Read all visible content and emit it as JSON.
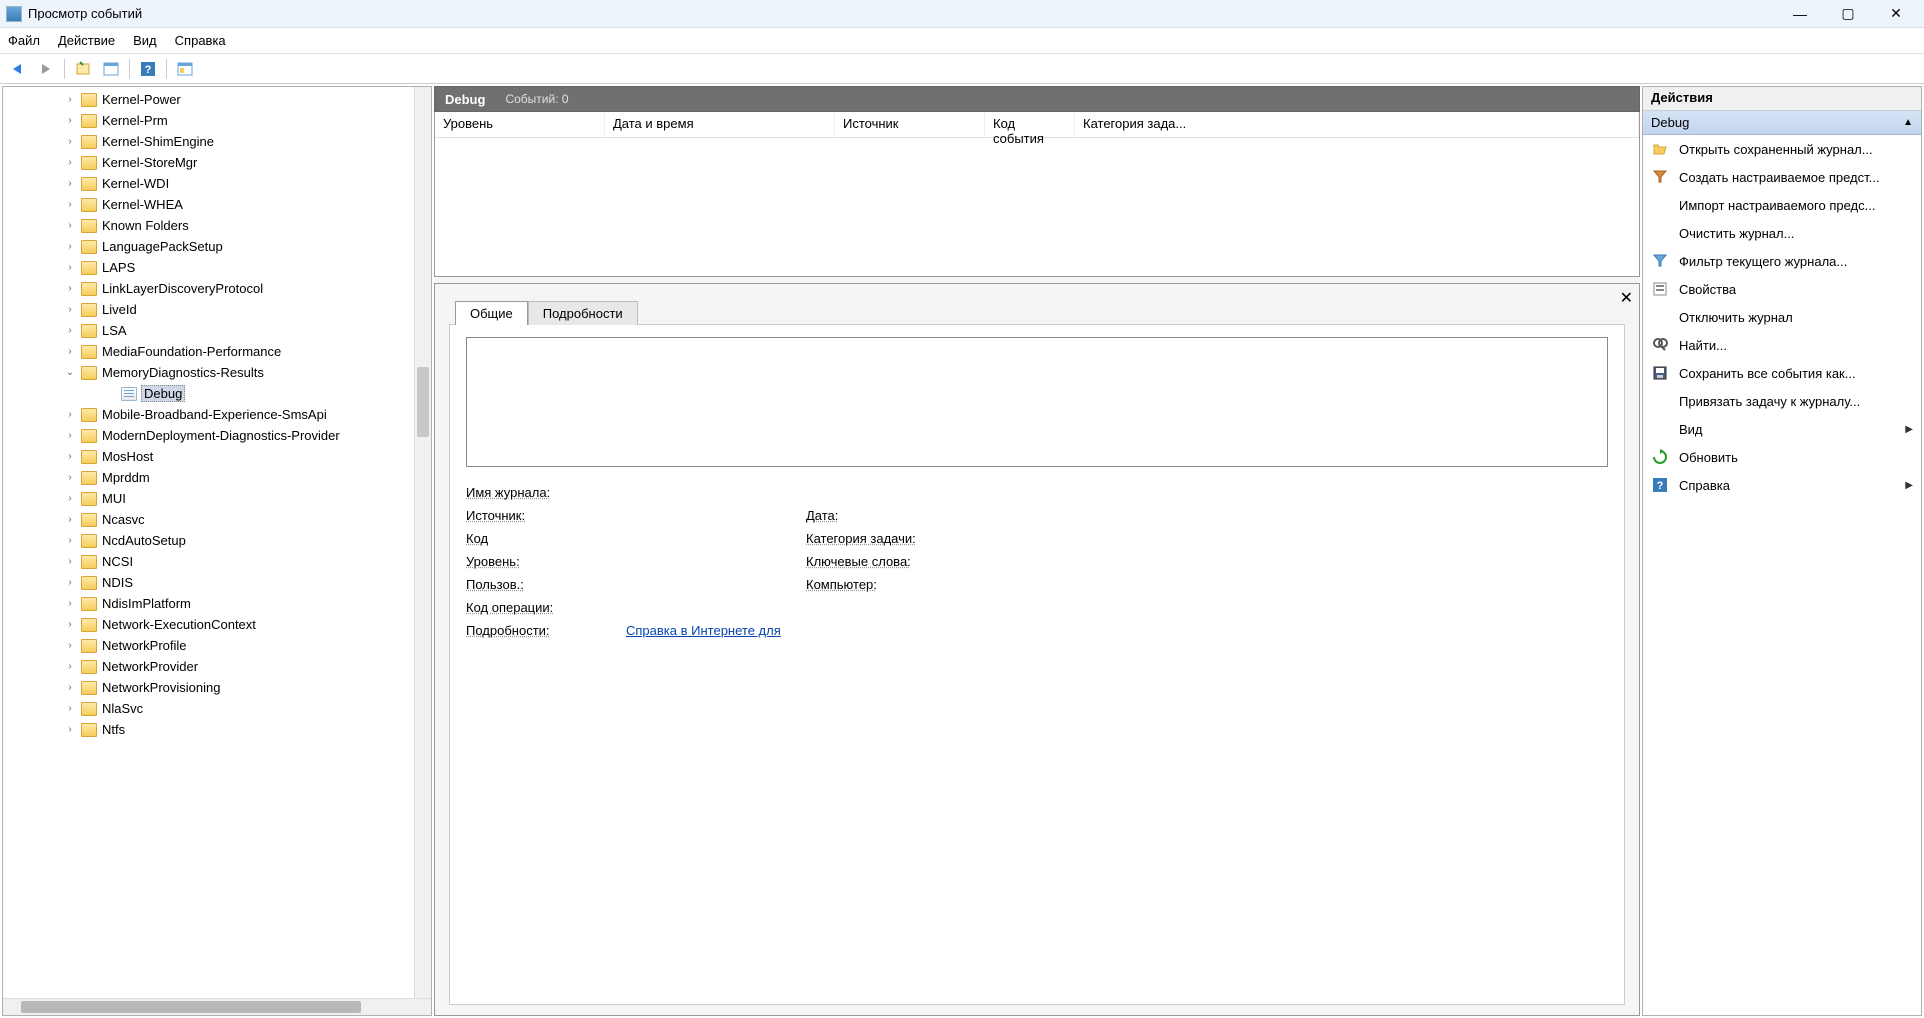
{
  "window": {
    "title": "Просмотр событий"
  },
  "menu": {
    "file": "Файл",
    "action": "Действие",
    "view": "Вид",
    "help": "Справка"
  },
  "tree": {
    "items": [
      {
        "label": "Kernel-Power",
        "exp": "›"
      },
      {
        "label": "Kernel-Prm",
        "exp": "›"
      },
      {
        "label": "Kernel-ShimEngine",
        "exp": "›"
      },
      {
        "label": "Kernel-StoreMgr",
        "exp": "›"
      },
      {
        "label": "Kernel-WDI",
        "exp": "›"
      },
      {
        "label": "Kernel-WHEA",
        "exp": "›"
      },
      {
        "label": "Known Folders",
        "exp": "›"
      },
      {
        "label": "LanguagePackSetup",
        "exp": "›"
      },
      {
        "label": "LAPS",
        "exp": "›"
      },
      {
        "label": "LinkLayerDiscoveryProtocol",
        "exp": "›"
      },
      {
        "label": "LiveId",
        "exp": "›"
      },
      {
        "label": "LSA",
        "exp": "›"
      },
      {
        "label": "MediaFoundation-Performance",
        "exp": "›"
      },
      {
        "label": "MemoryDiagnostics-Results",
        "exp": "⌄",
        "children": [
          {
            "label": "Debug",
            "selected": true
          }
        ]
      },
      {
        "label": "Mobile-Broadband-Experience-SmsApi",
        "exp": "›"
      },
      {
        "label": "ModernDeployment-Diagnostics-Provider",
        "exp": "›"
      },
      {
        "label": "MosHost",
        "exp": "›"
      },
      {
        "label": "Mprddm",
        "exp": "›"
      },
      {
        "label": "MUI",
        "exp": "›"
      },
      {
        "label": "Ncasvc",
        "exp": "›"
      },
      {
        "label": "NcdAutoSetup",
        "exp": "›"
      },
      {
        "label": "NCSI",
        "exp": "›"
      },
      {
        "label": "NDIS",
        "exp": "›"
      },
      {
        "label": "NdisImPlatform",
        "exp": "›"
      },
      {
        "label": "Network-ExecutionContext",
        "exp": "›"
      },
      {
        "label": "NetworkProfile",
        "exp": "›"
      },
      {
        "label": "NetworkProvider",
        "exp": "›"
      },
      {
        "label": "NetworkProvisioning",
        "exp": "›"
      },
      {
        "label": "NlaSvc",
        "exp": "›"
      },
      {
        "label": "Ntfs",
        "exp": "›"
      }
    ]
  },
  "center": {
    "title": "Debug",
    "sub": "Событий: 0",
    "columns": {
      "level": "Уровень",
      "date": "Дата и время",
      "source": "Источник",
      "code": "Код события",
      "task": "Категория зада..."
    }
  },
  "detail": {
    "tabGeneral": "Общие",
    "tabDetails": "Подробности",
    "fields": {
      "logname_l": "Имя журнала:",
      "source_l": "Источник:",
      "date_l": "Дата:",
      "eventid_l": "Код",
      "taskcat_l": "Категория задачи:",
      "level_l": "Уровень:",
      "keywords_l": "Ключевые слова:",
      "user_l": "Пользов.:",
      "computer_l": "Компьютер:",
      "opcode_l": "Код операции:",
      "moreinfo_l": "Подробности:",
      "moreinfo_link": "Справка в Интернете для "
    }
  },
  "actions": {
    "title": "Действия",
    "group": "Debug",
    "items": [
      {
        "label": "Открыть сохраненный журнал...",
        "icon": "open-folder"
      },
      {
        "label": "Создать настраиваемое предст...",
        "icon": "filter-new"
      },
      {
        "label": "Импорт настраиваемого предс...",
        "icon": ""
      },
      {
        "label": "Очистить журнал...",
        "icon": ""
      },
      {
        "label": "Фильтр текущего журнала...",
        "icon": "filter"
      },
      {
        "label": "Свойства",
        "icon": "properties"
      },
      {
        "label": "Отключить журнал",
        "icon": ""
      },
      {
        "label": "Найти...",
        "icon": "find"
      },
      {
        "label": "Сохранить все события как...",
        "icon": "save"
      },
      {
        "label": "Привязать задачу к журналу...",
        "icon": ""
      },
      {
        "label": "Вид",
        "icon": "",
        "arrow": true
      },
      {
        "label": "Обновить",
        "icon": "refresh"
      },
      {
        "label": "Справка",
        "icon": "help",
        "arrow": true
      }
    ]
  }
}
